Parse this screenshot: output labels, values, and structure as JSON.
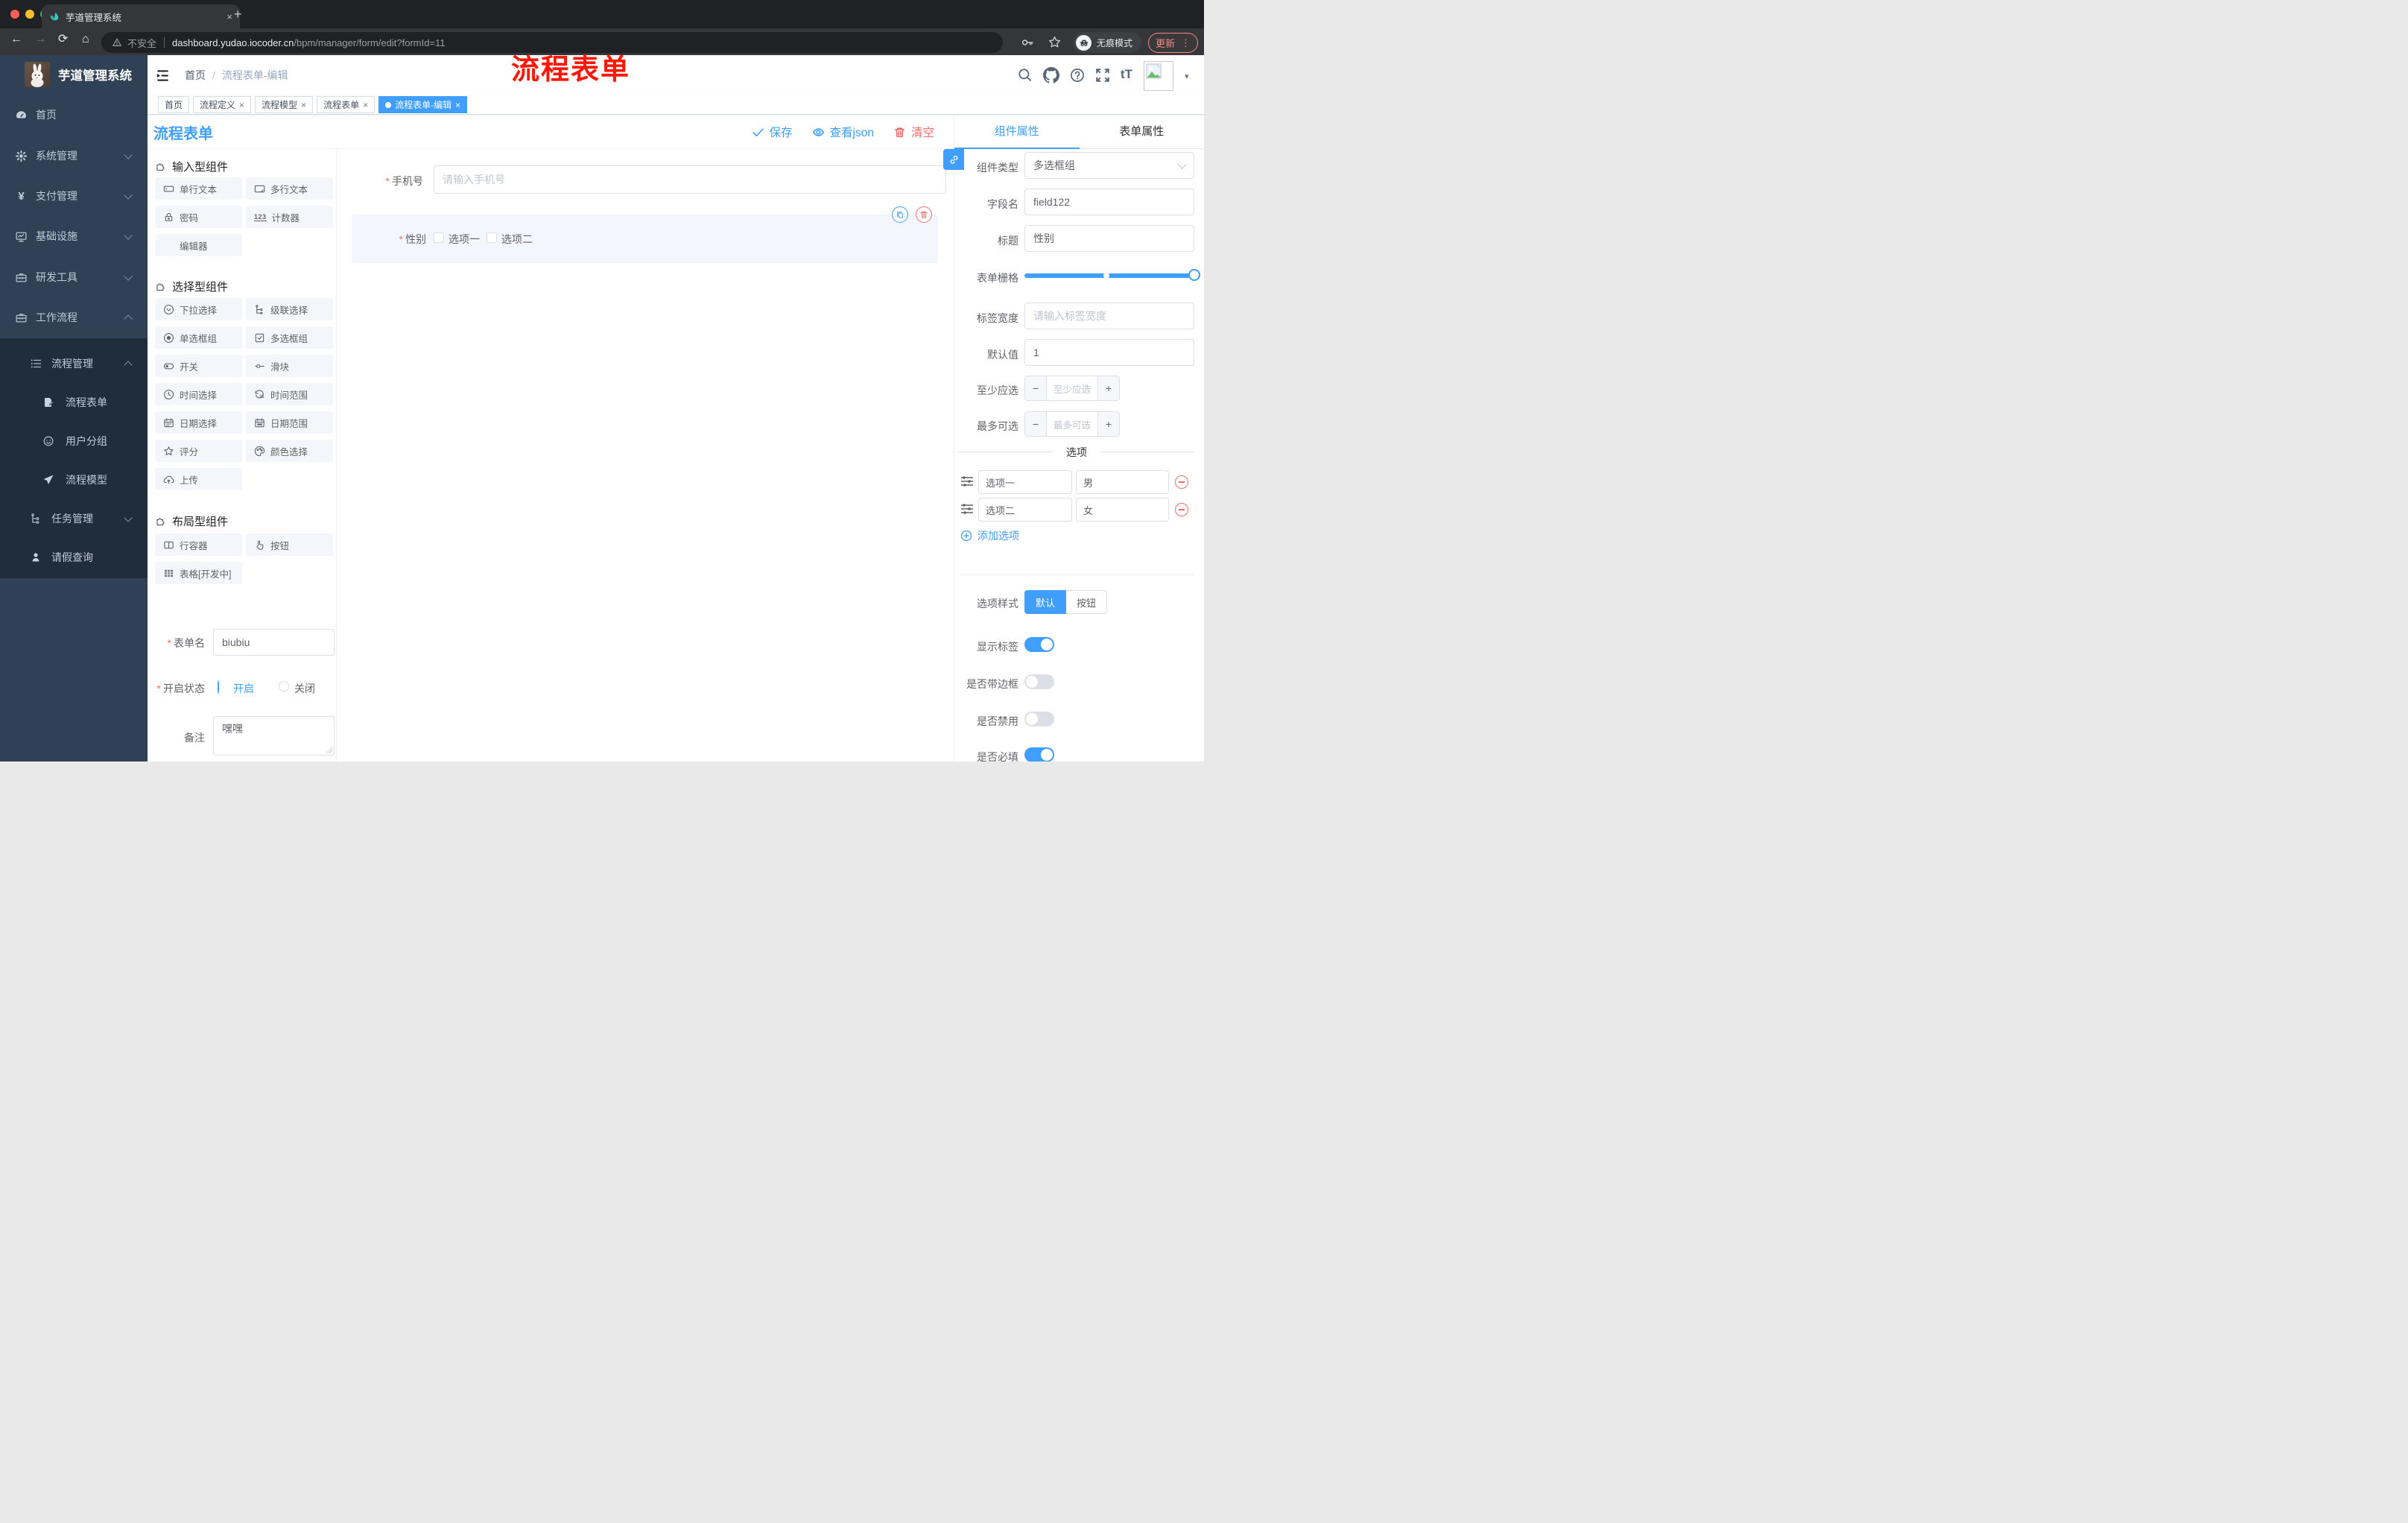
{
  "browser": {
    "tab_title": "芋道管理系统",
    "security_label": "不安全",
    "url_host": "dashboard.yudao.iocoder.cn",
    "url_path": "/bpm/manager/form/edit?formId=11",
    "incognito_label": "无痕模式",
    "update_label": "更新"
  },
  "symbols": {
    "close": "×",
    "plus": "+",
    "minus": "−",
    "slash": "/",
    "kebab": "⋮",
    "caret": "▾",
    "required": "*",
    "back": "←",
    "forward": "→",
    "reload": "⟳",
    "home": "⌂"
  },
  "icon_glyphs": {
    "font_size": "tT",
    "counter": "123",
    "yen": "¥"
  },
  "header": {
    "breadcrumb": [
      "首页",
      "流程表单-编辑"
    ],
    "annotation": "流程表单"
  },
  "tags": [
    {
      "label": "首页"
    },
    {
      "label": "流程定义"
    },
    {
      "label": "流程模型"
    },
    {
      "label": "流程表单"
    },
    {
      "label": "流程表单-编辑"
    }
  ],
  "sidebar": {
    "title": "芋道管理系统",
    "items": [
      {
        "label": "首页"
      },
      {
        "label": "系统管理"
      },
      {
        "label": "支付管理"
      },
      {
        "label": "基础设施"
      },
      {
        "label": "研发工具"
      },
      {
        "label": "工作流程"
      },
      {
        "label": "流程管理"
      },
      {
        "label": "流程表单"
      },
      {
        "label": "用户分组"
      },
      {
        "label": "流程模型"
      },
      {
        "label": "任务管理"
      },
      {
        "label": "请假查询"
      }
    ]
  },
  "toolbar": {
    "title": "流程表单",
    "save": "保存",
    "view_json": "查看json",
    "clear": "清空"
  },
  "components": {
    "groups": [
      {
        "title": "输入型组件",
        "items": [
          "单行文本",
          "多行文本",
          "密码",
          "计数器",
          "编辑器"
        ]
      },
      {
        "title": "选择型组件",
        "items": [
          "下拉选择",
          "级联选择",
          "单选框组",
          "多选框组",
          "开关",
          "滑块",
          "时间选择",
          "时间范围",
          "日期选择",
          "日期范围",
          "评分",
          "颜色选择",
          "上传"
        ]
      },
      {
        "title": "布局型组件",
        "items": [
          "行容器",
          "按钮",
          "表格[开发中]"
        ]
      }
    ]
  },
  "form_info": {
    "name_label": "表单名",
    "name_value": "biubiu",
    "status_label": "开启状态",
    "status_on": "开启",
    "status_off": "关闭",
    "remark_label": "备注",
    "remark_value": "嘿嘿"
  },
  "canvas": {
    "phone_label": "手机号",
    "phone_placeholder": "请输入手机号",
    "gender_label": "性别",
    "gender_options": [
      "选项一",
      "选项二"
    ]
  },
  "props": {
    "tabs": [
      "组件属性",
      "表单属性"
    ],
    "component_type_label": "组件类型",
    "component_type_value": "多选框组",
    "field_name_label": "字段名",
    "field_name_value": "field122",
    "title_label": "标题",
    "title_value": "性别",
    "grid_label": "表单栅格",
    "label_width_label": "标签宽度",
    "label_width_placeholder": "请输入标签宽度",
    "default_label": "默认值",
    "default_value": "1",
    "min_label": "至少应选",
    "min_placeholder": "至少应选",
    "max_label": "最多可选",
    "max_placeholder": "最多可选",
    "options_title": "选项",
    "options": [
      {
        "label": "选项一",
        "value": "男"
      },
      {
        "label": "选项二",
        "value": "女"
      }
    ],
    "add_option": "添加选项",
    "option_style_label": "选项样式",
    "option_style_options": [
      "默认",
      "按钮"
    ],
    "switches": [
      {
        "label": "显示标签"
      },
      {
        "label": "是否带边框"
      },
      {
        "label": "是否禁用"
      },
      {
        "label": "是否必填"
      }
    ]
  },
  "colors": {
    "primary": "#409EFF",
    "danger": "#F56C6C",
    "annotation": "#FF1708"
  }
}
